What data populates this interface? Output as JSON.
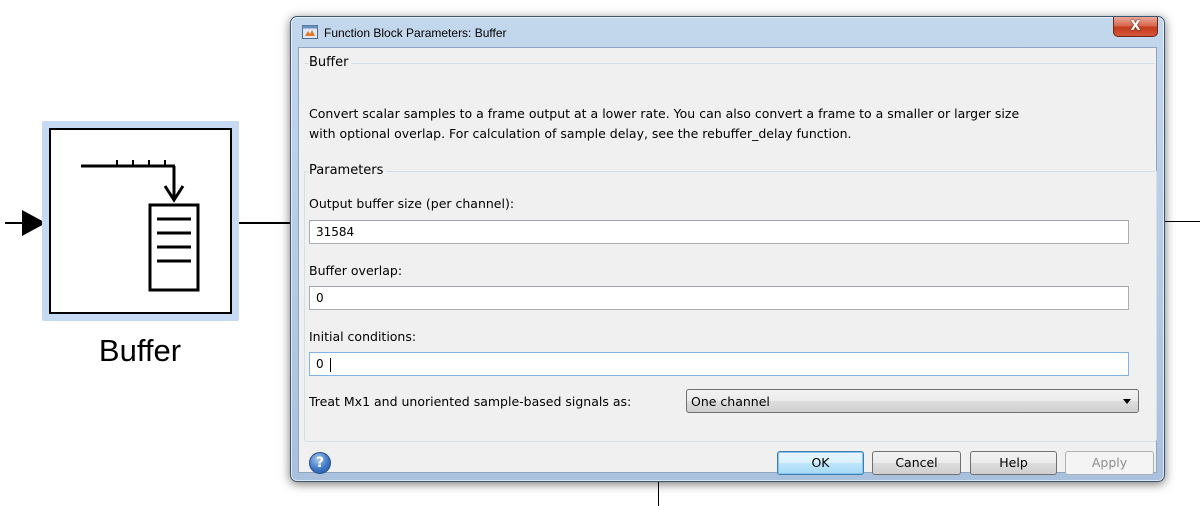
{
  "canvas": {
    "block_label": "Buffer"
  },
  "dialog": {
    "title": "Function Block Parameters: Buffer",
    "close_label": "X",
    "section_block": "Buffer",
    "description_line1": "Convert scalar samples to a frame output at a lower rate. You can also convert a frame to a smaller or larger size",
    "description_line2": "with optional overlap. For calculation of sample delay, see the rebuffer_delay function.",
    "section_parameters": "Parameters",
    "fields": [
      {
        "label": "Output buffer size (per channel):",
        "value": "31584"
      },
      {
        "label": "Buffer overlap:",
        "value": "0"
      },
      {
        "label": "Initial conditions:",
        "value": "0"
      }
    ],
    "select": {
      "label": "Treat Mx1 and unoriented sample-based signals as:",
      "value": "One channel"
    },
    "buttons": {
      "help_icon": "?",
      "ok": "OK",
      "cancel": "Cancel",
      "help": "Help",
      "apply": "Apply"
    }
  },
  "icons": [
    "input-port-arrow",
    "buffer-block-icon",
    "app-icon",
    "close-icon",
    "help-icon",
    "dropdown-arrow-icon"
  ]
}
